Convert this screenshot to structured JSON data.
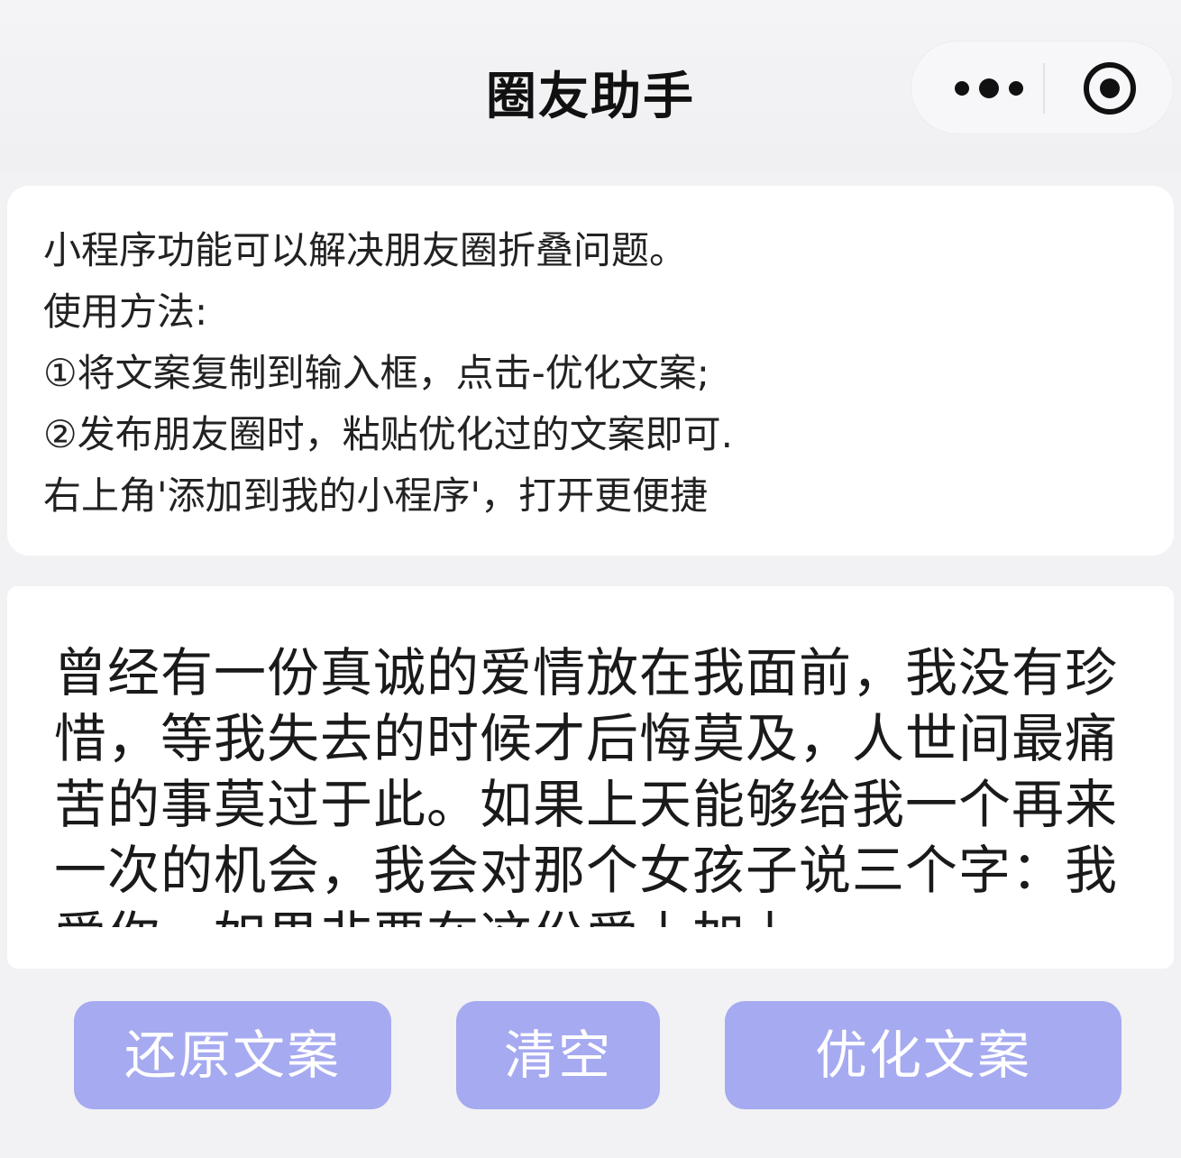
{
  "nav": {
    "title": "圈友助手"
  },
  "capsule": {
    "more_icon": "more-dots-icon",
    "close_icon": "target-circle-icon"
  },
  "notice": {
    "lines": [
      "小程序功能可以解决朋友圈折叠问题。",
      "使用方法:",
      "①将文案复制到输入框，点击-优化文案;",
      "②发布朋友圈时，粘贴优化过的文案即可.",
      "右上角'添加到我的小程序'，打开更便捷"
    ]
  },
  "editor": {
    "value": "曾经有一份真诚的爱情放在我面前，我没有珍惜，等我失去的时候才后悔莫及，人世间最痛苦的事莫过于此。如果上天能够给我一个再来一次的机会，我会对那个女孩子说三个字：我爱你。如果非要在这份爱上加上"
  },
  "buttons": {
    "restore_label": "还原文案",
    "clear_label": "清空",
    "optimize_label": "优化文案"
  },
  "colors": {
    "button_bg": "#a6aaf0",
    "page_bg": "#f2f2f4"
  }
}
